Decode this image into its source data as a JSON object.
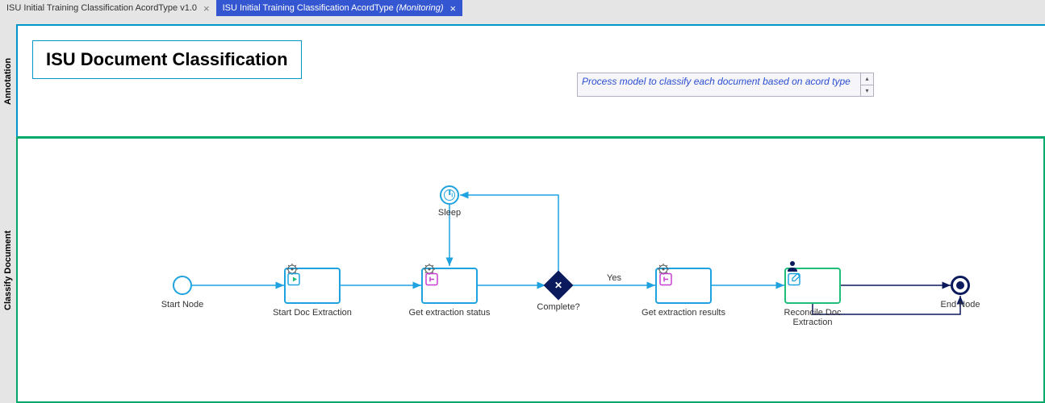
{
  "tabs": [
    {
      "label": "ISU Initial Training Classification AcordType v1.0",
      "active": false
    },
    {
      "label": "ISU Initial Training Classification AcordType",
      "suffix": "(Monitoring)",
      "active": true
    }
  ],
  "lanes": {
    "annotation_label": "Annotation",
    "classify_label": "Classify Document"
  },
  "title": "ISU Document Classification",
  "description": "Process model to classify each document based on acord type",
  "nodes": {
    "start": {
      "label": "Start Node"
    },
    "start_doc": {
      "label": "Start Doc Extraction"
    },
    "get_status": {
      "label": "Get extraction status"
    },
    "sleep": {
      "label": "Sleep"
    },
    "complete": {
      "label": "Complete?"
    },
    "get_results": {
      "label": "Get extraction results"
    },
    "reconcile": {
      "label": "Reconcile Doc Extraction"
    },
    "end": {
      "label": "End Node"
    }
  },
  "edges": {
    "yes": "Yes"
  },
  "colors": {
    "lane_annotation": "#0096c7",
    "lane_classify": "#00a86b",
    "flow": "#1fa3e0",
    "dark": "#0b1a5c",
    "magenta": "#c83fcf",
    "green": "#1fbf7a"
  }
}
